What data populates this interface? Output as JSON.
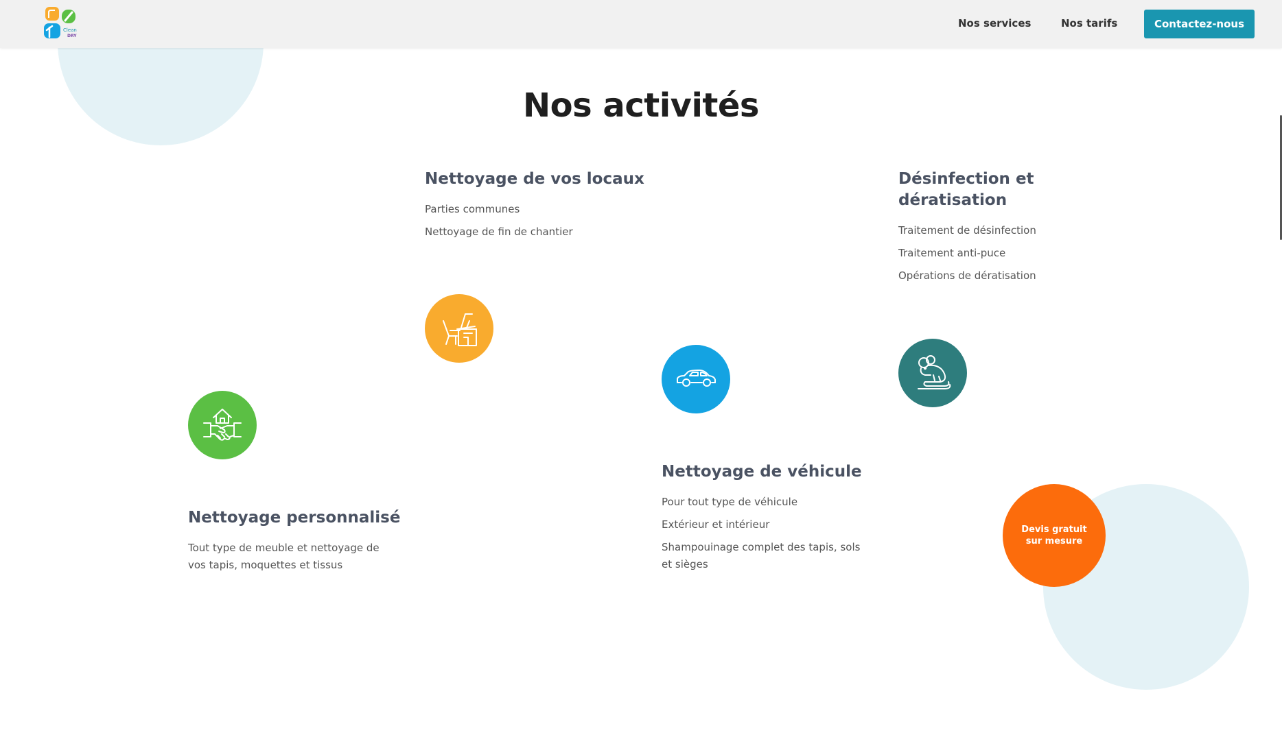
{
  "header": {
    "logo_text": "Clean DRY",
    "nav": [
      {
        "label": "Nos services"
      },
      {
        "label": "Nos tarifs"
      }
    ],
    "contact_label": "Contactez-nous"
  },
  "section": {
    "title": "Nos activités"
  },
  "activities": [
    {
      "title": "Nettoyage de vos locaux",
      "items": [
        "Parties communes",
        "Nettoyage de fin de chantier"
      ],
      "icon": "office-desk-icon",
      "color": "#f9ab2e"
    },
    {
      "title": "Désinfection et dératisation",
      "items": [
        "Traitement de désinfection",
        "Traitement anti-puce",
        "Opérations de dératisation"
      ],
      "icon": "rat-icon",
      "color": "#2e7d7d"
    },
    {
      "title": "Nettoyage de véhicule",
      "items": [
        "Pour tout type de véhicule",
        "Extérieur et intérieur",
        "Shampouinage complet des tapis, sols et sièges"
      ],
      "icon": "car-icon",
      "color": "#14a3e2"
    },
    {
      "title": "Nettoyage personnalisé",
      "description": "Tout type de meuble et nettoyage de vos tapis, moquettes et tissus",
      "icon": "handshake-house-icon",
      "color": "#5bbf44"
    }
  ],
  "cta": {
    "label": "Devis gratuit sur mesure",
    "color": "#fc6c0c"
  },
  "colors": {
    "accent": "#1a96b0",
    "decor": "#e4f2f6"
  }
}
